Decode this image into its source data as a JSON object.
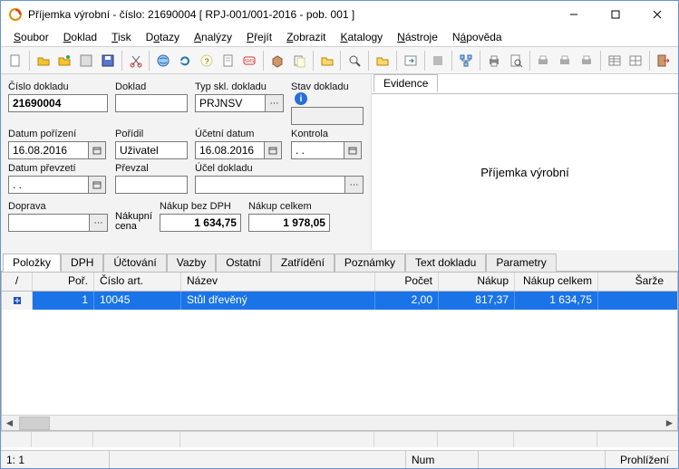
{
  "window": {
    "title": "Příjemka výrobní - číslo: 21690004  [ RPJ-001/001-2016 - pob. 001 ]"
  },
  "menu": {
    "items": [
      {
        "raw": "Soubor",
        "u": 0
      },
      {
        "raw": "Doklad",
        "u": 0
      },
      {
        "raw": "Tisk",
        "u": 0
      },
      {
        "raw": "Dotazy",
        "u": 1
      },
      {
        "raw": "Analýzy",
        "u": 0
      },
      {
        "raw": "Přejít",
        "u": 0
      },
      {
        "raw": "Zobrazit",
        "u": 0
      },
      {
        "raw": "Katalogy",
        "u": 0
      },
      {
        "raw": "Nástroje",
        "u": 0
      },
      {
        "raw": "Nápověda",
        "u": 1
      }
    ]
  },
  "toolbar_icons": [
    "new",
    "sep",
    "open",
    "open2",
    "save",
    "save-disk",
    "sep",
    "cut",
    "sep",
    "globe",
    "refresh",
    "help",
    "doc",
    "sms",
    "sep",
    "box",
    "copy",
    "sep",
    "folder",
    "sep",
    "find",
    "sep",
    "folder2",
    "sep",
    "goto",
    "sep",
    "gray",
    "sep",
    "tree",
    "sep",
    "print",
    "preview",
    "sep",
    "print2",
    "print3",
    "print4",
    "sep",
    "grid",
    "grid2",
    "sep",
    "exit"
  ],
  "form": {
    "doc_no_lbl": "Číslo dokladu",
    "doc_no": "21690004",
    "doklad_lbl": "Doklad",
    "doklad": "",
    "typ_lbl": "Typ skl. dokladu",
    "typ": "PRJNSV",
    "stav_lbl": "Stav dokladu",
    "stav": "",
    "datum_por_lbl": "Datum pořízení",
    "datum_por": "16.08.2016",
    "poridil_lbl": "Pořídil",
    "poridil": "Uživatel",
    "ucet_dat_lbl": "Účetní datum",
    "ucet_dat": "16.08.2016",
    "kontrola_lbl": "Kontrola",
    "kontrola": ". .",
    "datum_prev_lbl": "Datum převzetí",
    "datum_prev": ". .",
    "prevzal_lbl": "Převzal",
    "prevzal": "",
    "ucel_lbl": "Účel dokladu",
    "ucel": "",
    "doprava_lbl": "Doprava",
    "doprava": "",
    "nakup_cena_lbl1": "Nákupní",
    "nakup_cena_lbl2": "cena",
    "nakup_bez_lbl": "Nákup bez DPH",
    "nakup_bez": "1 634,75",
    "nakup_celk_lbl": "Nákup celkem",
    "nakup_celk": "1 978,05"
  },
  "evidence": {
    "tab": "Evidence",
    "body": "Příjemka výrobní"
  },
  "tabs": [
    "Položky",
    "DPH",
    "Účtování",
    "Vazby",
    "Ostatní",
    "Zatřídění",
    "Poznámky",
    "Text dokladu",
    "Parametry"
  ],
  "grid": {
    "headers": {
      "handle": "/",
      "por": "Poř.",
      "art": "Číslo art.",
      "name": "Název",
      "poc": "Počet",
      "nak": "Nákup",
      "nakc": "Nákup celkem",
      "sarz": "Šarže"
    },
    "rows": [
      {
        "por": "1",
        "art": "10045",
        "name": "Stůl dřevěný",
        "poc": "2,00",
        "nak": "817,37",
        "nakc": "1 634,75",
        "sarz": ""
      }
    ]
  },
  "status": {
    "pos": "1:   1",
    "num": "Num",
    "mode": "Prohlížení"
  }
}
